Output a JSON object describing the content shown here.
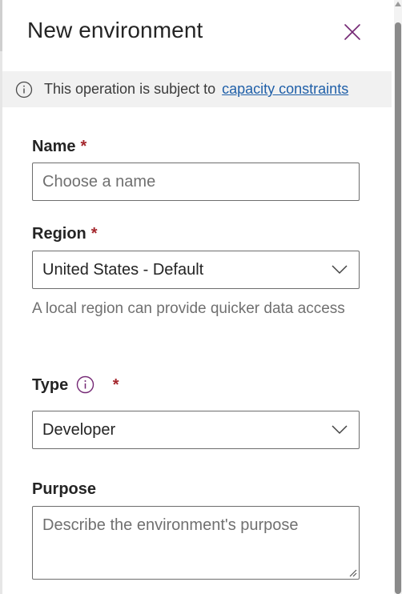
{
  "panel": {
    "title": "New environment"
  },
  "banner": {
    "text": "This operation is subject to",
    "link": "capacity constraints"
  },
  "form": {
    "name": {
      "label": "Name",
      "required_mark": "*",
      "placeholder": "Choose a name",
      "value": ""
    },
    "region": {
      "label": "Region",
      "required_mark": "*",
      "value": "United States - Default",
      "helper": "A local region can provide quicker data access"
    },
    "type": {
      "label": "Type",
      "required_mark": "*",
      "value": "Developer"
    },
    "purpose": {
      "label": "Purpose",
      "placeholder": "Describe the environment's purpose",
      "value": ""
    }
  },
  "colors": {
    "required": "#a4262c",
    "link": "#1f5fa8",
    "accent": "#742774",
    "banner_bg": "#f1f1f1"
  },
  "icons": {
    "close": "close-icon",
    "info": "info-icon",
    "chevron": "chevron-down-icon"
  }
}
